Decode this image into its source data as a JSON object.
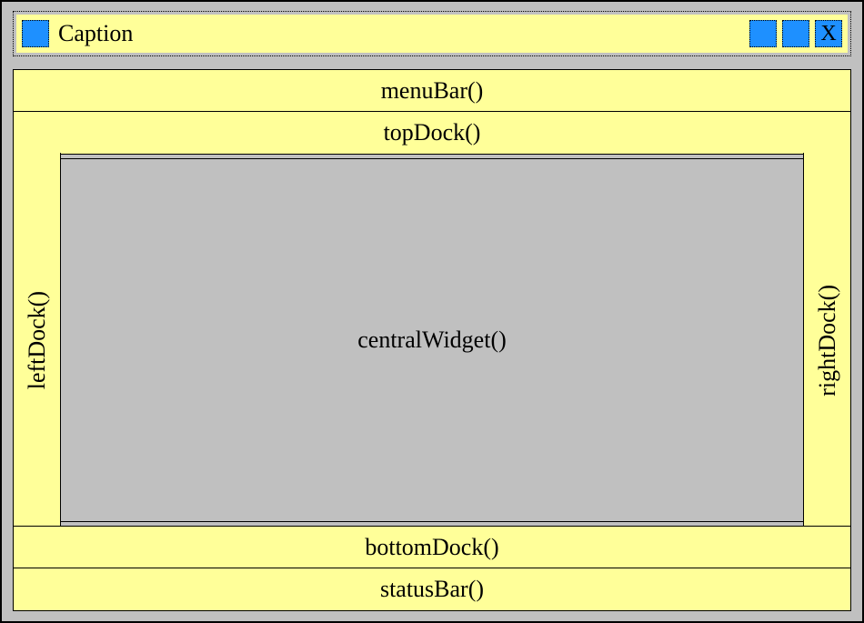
{
  "titlebar": {
    "caption": "Caption",
    "close_label": "X"
  },
  "layout": {
    "menubar": "menuBar()",
    "topdock": "topDock()",
    "leftdock": "leftDock()",
    "central": "centralWidget()",
    "rightdock": "rightDock()",
    "bottomdock": "bottomDock()",
    "statusbar": "statusBar()"
  },
  "colors": {
    "panel": "#ffff99",
    "accent": "#1e90ff",
    "bg": "#c0c0c0"
  }
}
